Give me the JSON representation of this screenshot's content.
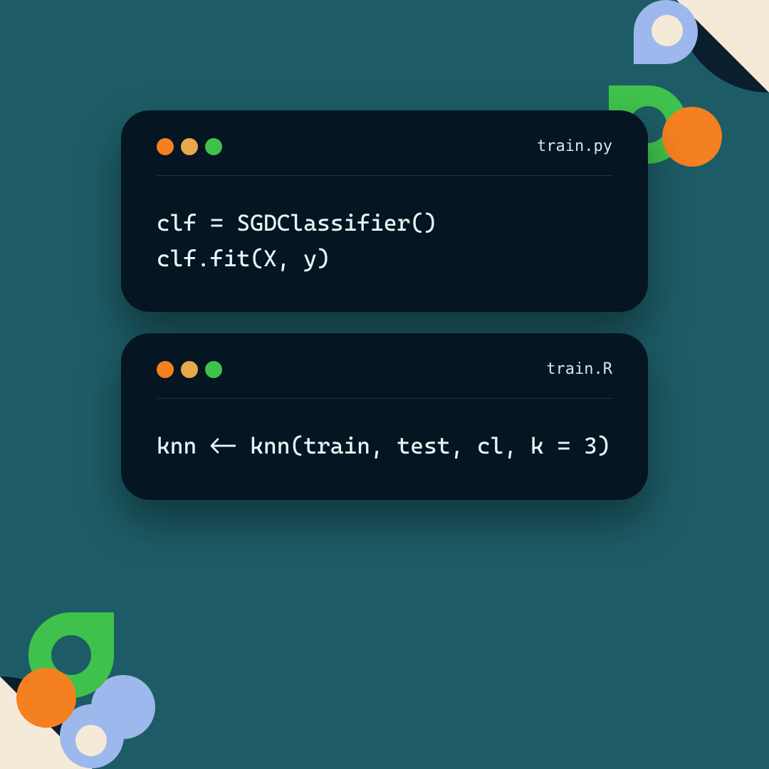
{
  "cards": [
    {
      "filename": "train.py",
      "code": "clf = SGDClassifier()\nclf.fit(X, y)"
    },
    {
      "filename": "train.R",
      "code": "knn <- knn(train, test, cl, k = 3)"
    }
  ],
  "colors": {
    "background": "#1d5c66",
    "cardBackground": "#051521",
    "text": "#e8f4f6",
    "orange": "#f58020",
    "green": "#3fc24b",
    "lightBlue": "#9db8ec",
    "cream": "#f5ead8",
    "darkNavy": "#0a1e2d"
  }
}
